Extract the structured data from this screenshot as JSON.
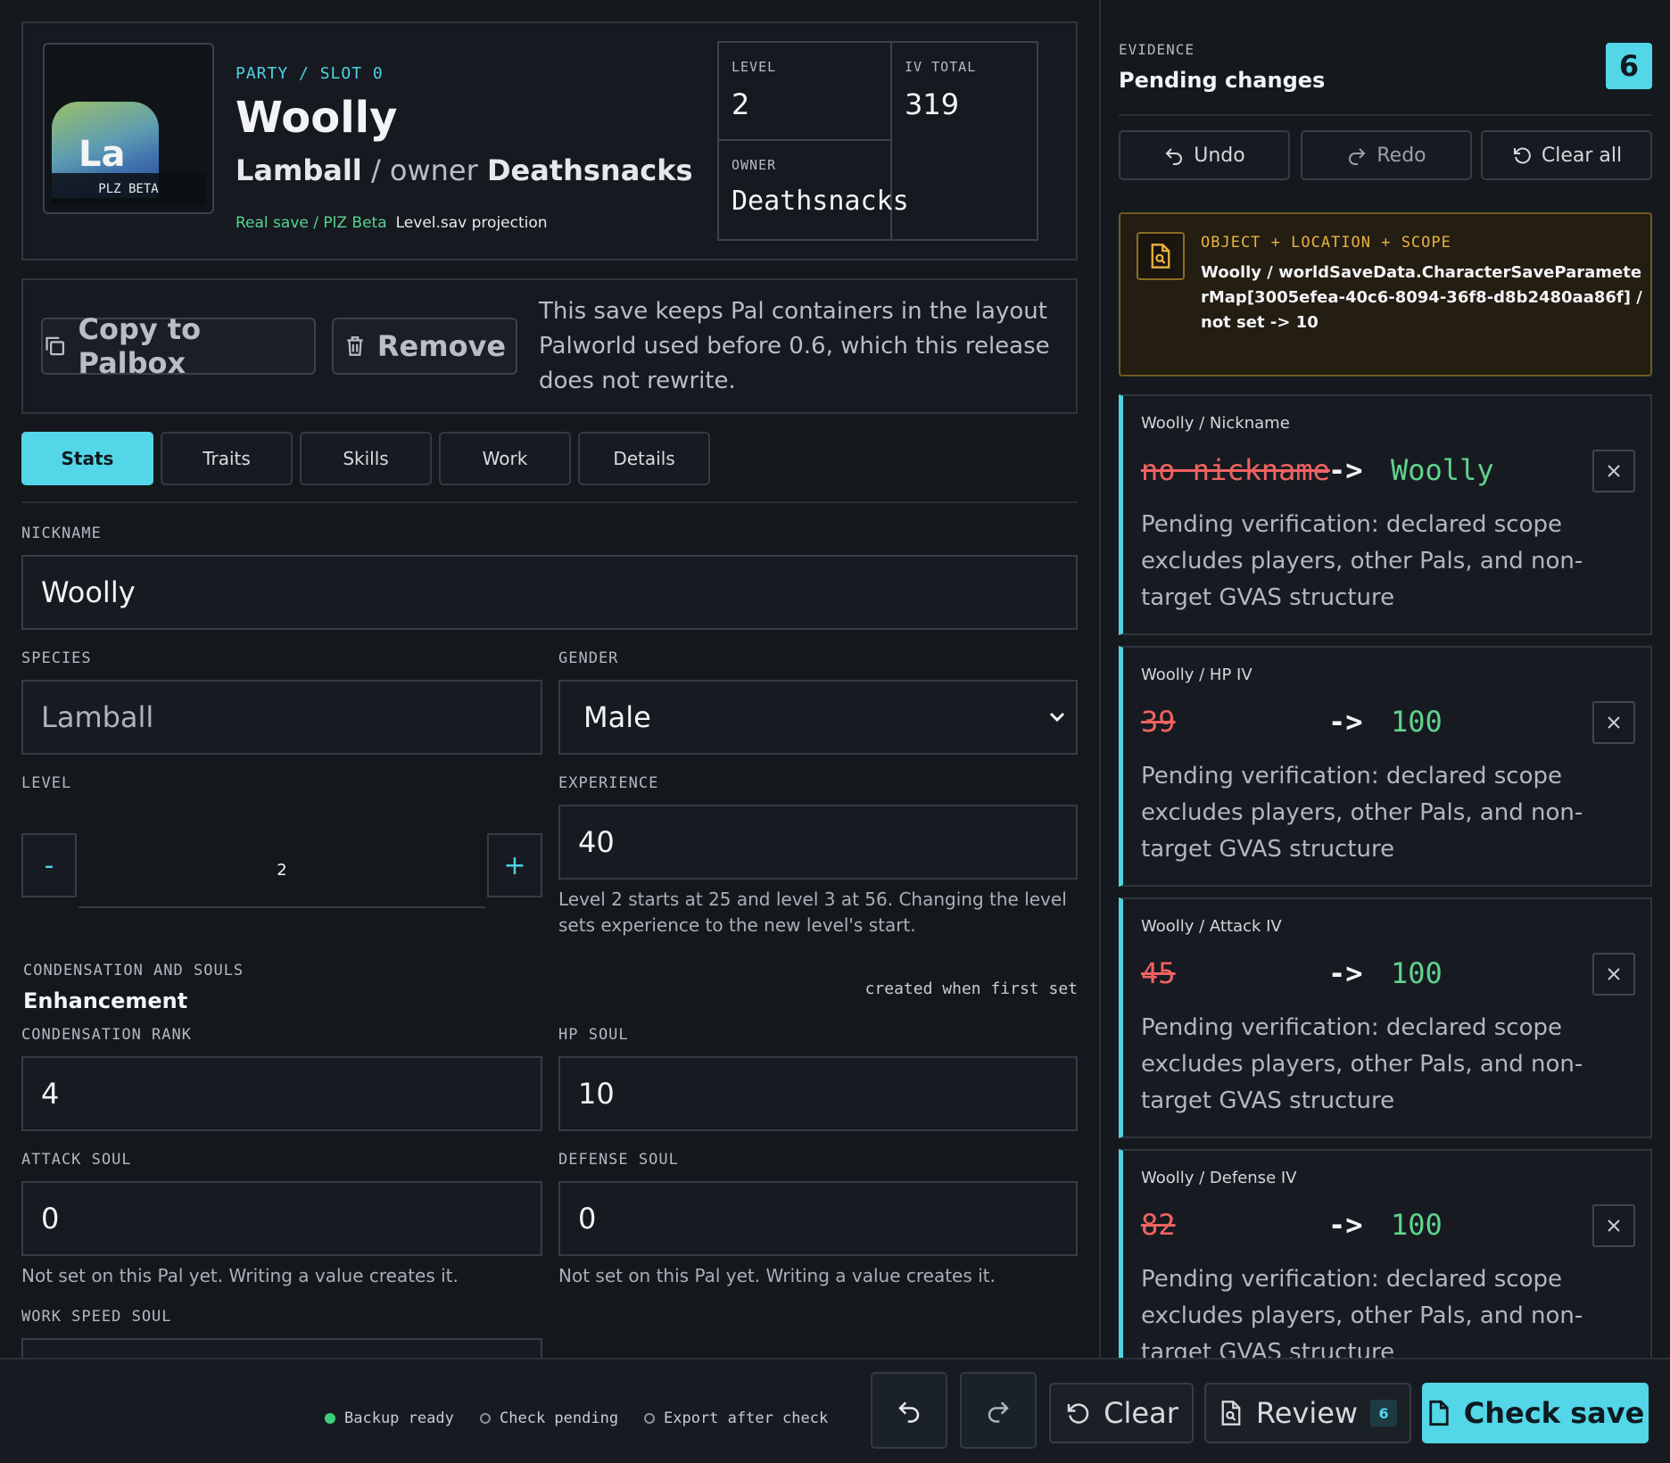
{
  "header": {
    "avatar_abbr": "La",
    "avatar_tag": "PLZ BETA",
    "crumb": "PARTY / SLOT 0",
    "name": "Woolly",
    "species": "Lamball",
    "owner_sep": "/ owner",
    "owner": "Deathsnacks",
    "source": "Real save / PlZ Beta",
    "projection": "Level.sav projection",
    "stats": {
      "level_label": "LEVEL",
      "level": "2",
      "iv_label": "IV TOTAL",
      "iv": "319",
      "owner_label": "OWNER",
      "owner": "Deathsnacks"
    }
  },
  "actions": {
    "copy": "Copy to Palbox",
    "remove": "Remove",
    "note": "This save keeps Pal containers in the layout Palworld used before 0.6, which this release does not rewrite."
  },
  "tabs": [
    {
      "label": "Stats",
      "active": true
    },
    {
      "label": "Traits"
    },
    {
      "label": "Skills"
    },
    {
      "label": "Work"
    },
    {
      "label": "Details"
    }
  ],
  "form": {
    "nickname_label": "NICKNAME",
    "nickname": "Woolly",
    "species_label": "SPECIES",
    "species": "Lamball",
    "gender_label": "GENDER",
    "gender": "Male",
    "level_label": "LEVEL",
    "level": "2",
    "level_minus": "-",
    "level_plus": "+",
    "experience_label": "EXPERIENCE",
    "experience": "40",
    "experience_help": "Level 2 starts at 25 and level 3 at 56. Changing the level sets experience to the new level's start.",
    "enh_kicker": "CONDENSATION AND SOULS",
    "enh_title": "Enhancement",
    "enh_note": "created when first set",
    "condensation_label": "CONDENSATION RANK",
    "condensation": "4",
    "hp_soul_label": "HP SOUL",
    "hp_soul": "10",
    "attack_soul_label": "ATTACK SOUL",
    "attack_soul": "0",
    "defense_soul_label": "DEFENSE SOUL",
    "defense_soul": "0",
    "unset_help": "Not set on this Pal yet. Writing a value creates it.",
    "work_speed_label": "WORK SPEED SOUL"
  },
  "evidence": {
    "kicker": "EVIDENCE",
    "title": "Pending changes",
    "count": "6",
    "undo": "Undo",
    "redo": "Redo",
    "clear_all": "Clear all",
    "scope_kicker": "OBJECT + LOCATION + SCOPE",
    "scope_value": "Woolly / worldSaveData.CharacterSaveParameterMap[3005efea-40c6-8094-36f8-d8b2480aa86f] / not set -> 10",
    "changes": [
      {
        "field": "Woolly / Nickname",
        "old": "no nickname",
        "arrow": "->",
        "new": "Woolly",
        "desc": "Pending verification: declared scope excludes players, other Pals, and non-target GVAS structure"
      },
      {
        "field": "Woolly / HP IV",
        "old": "39",
        "arrow": "->",
        "new": "100",
        "desc": "Pending verification: declared scope excludes players, other Pals, and non-target GVAS structure"
      },
      {
        "field": "Woolly / Attack IV",
        "old": "45",
        "arrow": "->",
        "new": "100",
        "desc": "Pending verification: declared scope excludes players, other Pals, and non-target GVAS structure"
      },
      {
        "field": "Woolly / Defense IV",
        "old": "82",
        "arrow": "->",
        "new": "100",
        "desc": "Pending verification: declared scope excludes players, other Pals, and non-target GVAS structure"
      }
    ]
  },
  "footer": {
    "status": [
      {
        "label": "Backup ready",
        "state": "ok",
        "color": "#3fcf7c"
      },
      {
        "label": "Check pending",
        "state": "pending"
      },
      {
        "label": "Export after check",
        "state": "pending"
      }
    ],
    "clear": "Clear",
    "review": "Review",
    "review_count": "6",
    "check": "Check save"
  },
  "colors": {
    "accent": "#52d6e8",
    "added": "#5fd38e",
    "removed": "#f06262",
    "warning": "#e9b340"
  }
}
